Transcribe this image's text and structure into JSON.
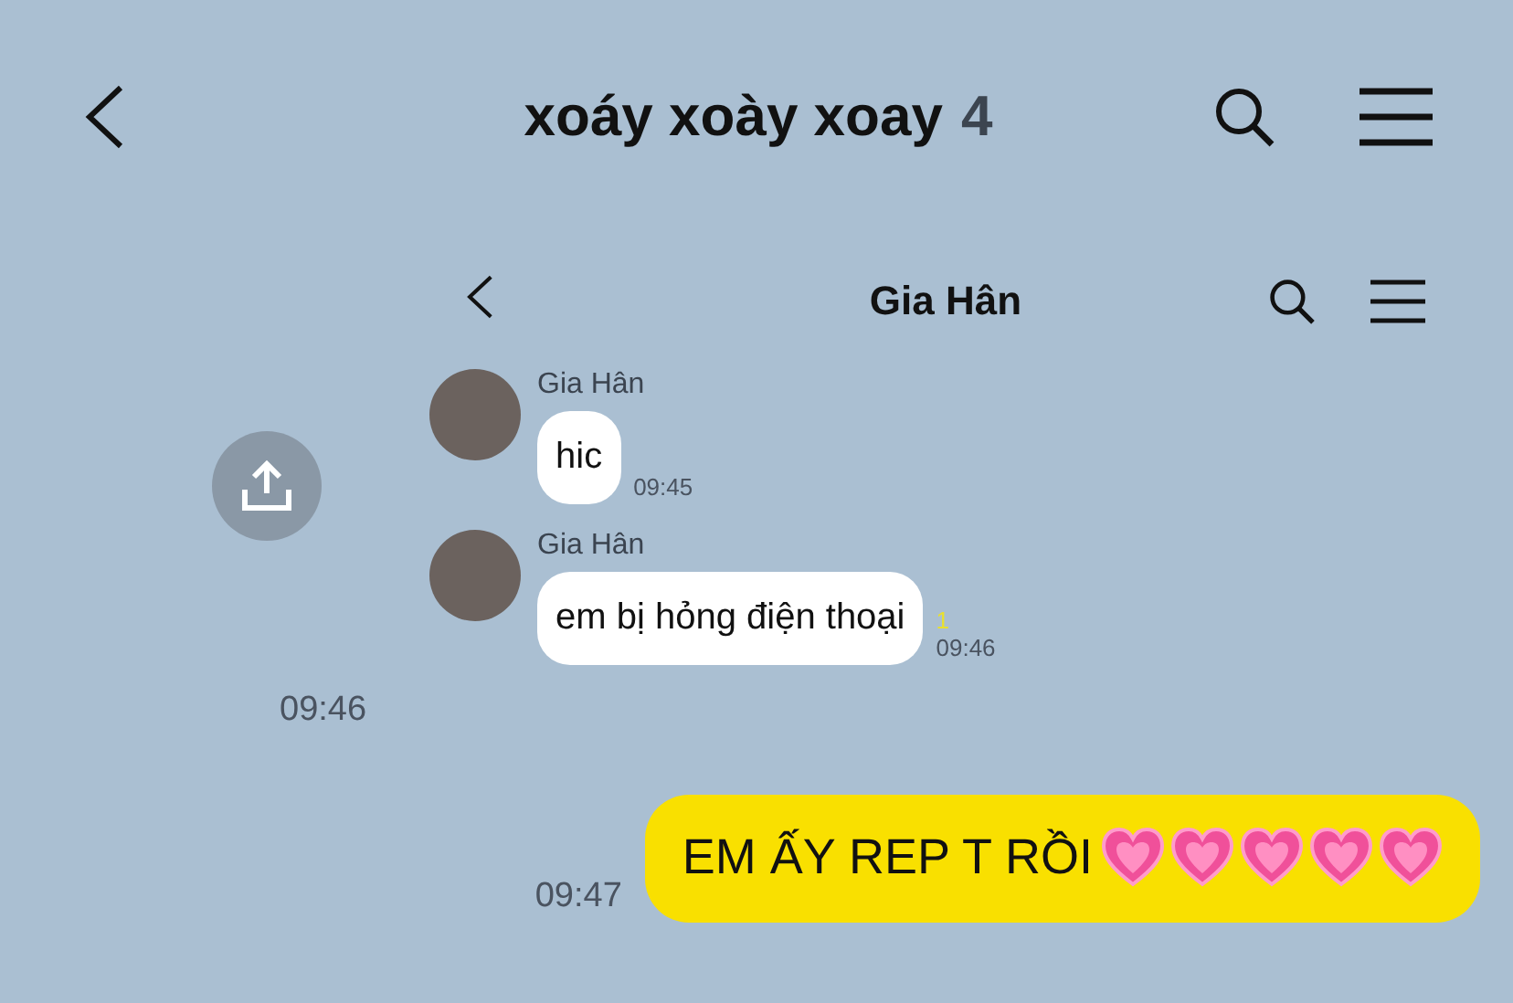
{
  "header": {
    "title": "xoáy xoày xoay",
    "member_count": "4"
  },
  "shared_image": {
    "header": {
      "title": "Gia Hân"
    },
    "messages": [
      {
        "sender": "Gia Hân",
        "text": "hic",
        "time": "09:45"
      },
      {
        "sender": "Gia Hân",
        "text": "em bị hỏng điện thoại",
        "read_count": "1",
        "time": "09:46"
      }
    ],
    "time": "09:46"
  },
  "own_message": {
    "text": "EM ẤY REP T RỒI",
    "reactions": [
      {
        "kind": "heart"
      },
      {
        "kind": "heart"
      },
      {
        "kind": "heart"
      },
      {
        "kind": "heart"
      },
      {
        "kind": "heart"
      }
    ],
    "time": "09:47"
  }
}
